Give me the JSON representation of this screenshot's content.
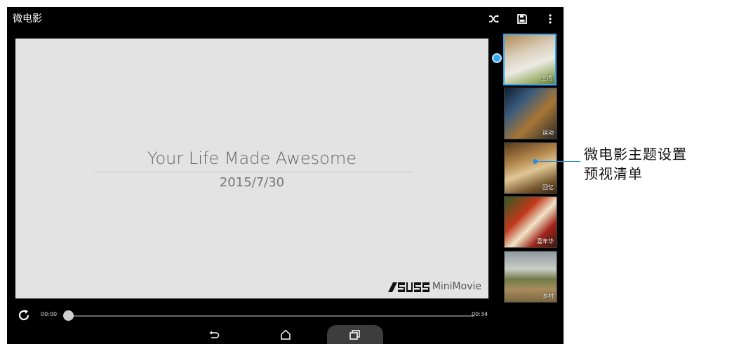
{
  "app": {
    "title": "微电影"
  },
  "toolbar": {
    "shuffle_icon": "shuffle-icon",
    "save_icon": "save-icon",
    "more_icon": "more-vert-icon"
  },
  "preview": {
    "title": "Your Life Made Awesome",
    "date": "2015/7/30",
    "brand_logo": "ASUS",
    "brand_text": "MiniMovie"
  },
  "themes": [
    {
      "label": "生活",
      "selected": true
    },
    {
      "label": "运动",
      "selected": false
    },
    {
      "label": "回忆",
      "selected": false
    },
    {
      "label": "嘉年华",
      "selected": false
    },
    {
      "label": "乡村",
      "selected": false
    }
  ],
  "player": {
    "current_time": "00:00",
    "total_time": "00:34",
    "progress": 0
  },
  "nav": {
    "back_icon": "back-icon",
    "home_icon": "home-icon",
    "recent_icon": "recent-apps-icon"
  },
  "callout": {
    "line1": "微电影主题设置",
    "line2": "预视清单"
  },
  "colors": {
    "accent": "#39a7ee",
    "callout": "#2c8fd6",
    "background": "#000000",
    "preview_bg": "#e3e3e3"
  }
}
